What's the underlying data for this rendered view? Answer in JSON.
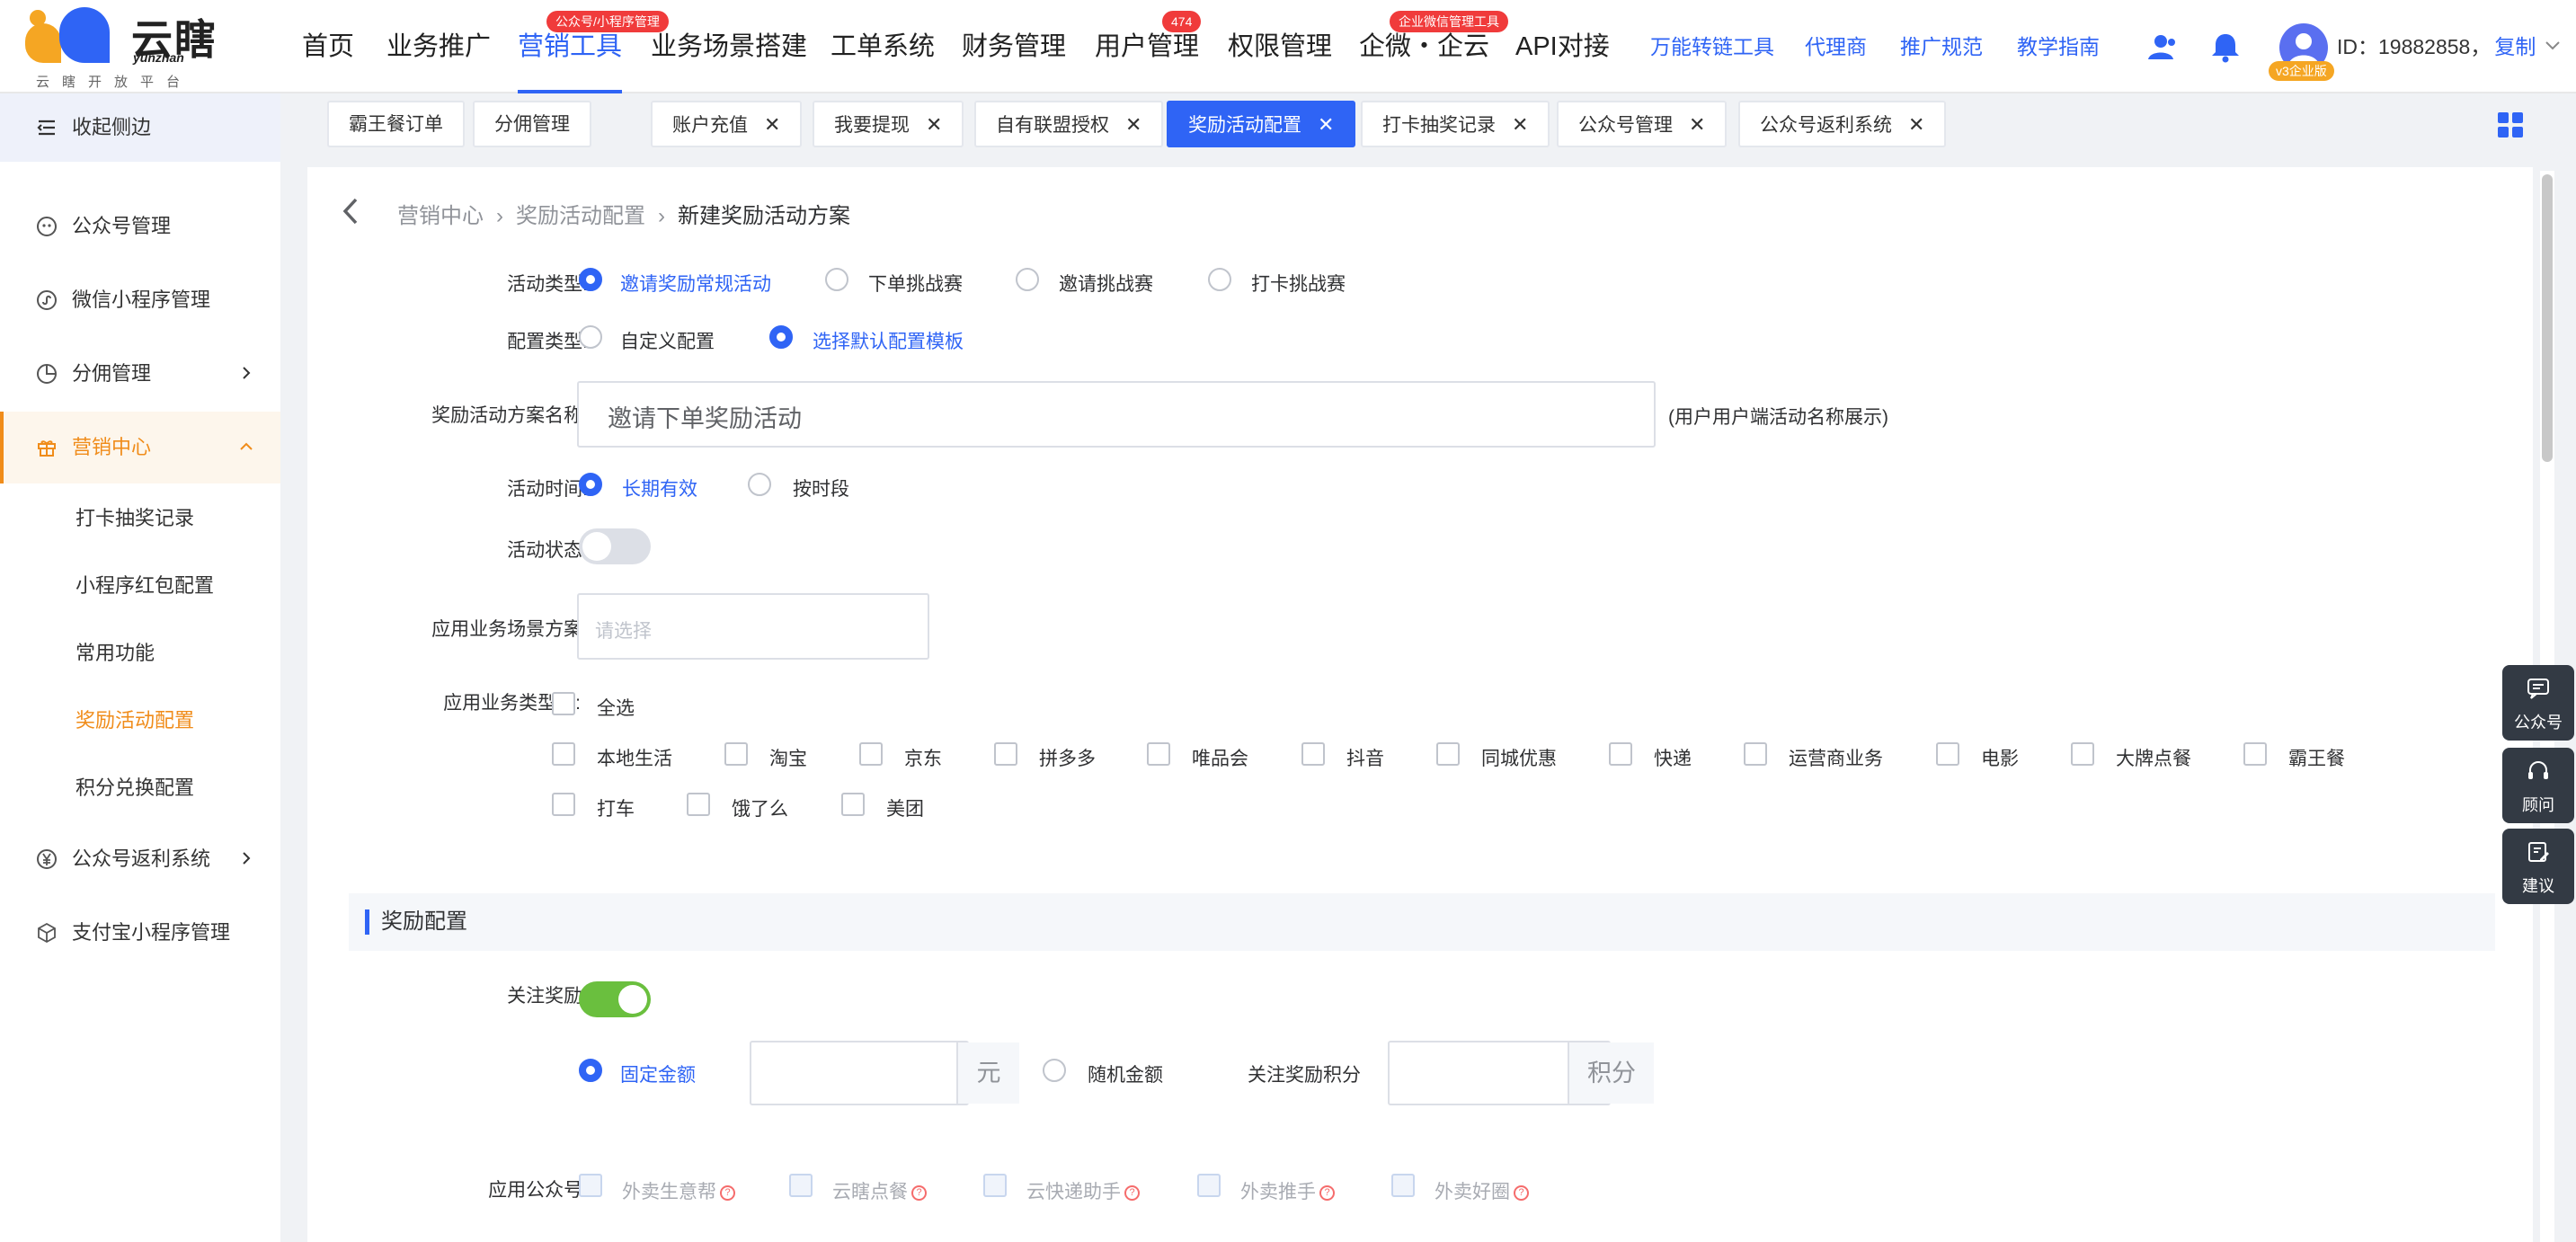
{
  "header": {
    "logo_text": "云瞎",
    "logo_en": "yunzhan",
    "logo_sub": "云瞎开放平台",
    "nav": [
      {
        "label": "首页"
      },
      {
        "label": "业务推广"
      },
      {
        "label": "营销工具",
        "badge": "公众号/小程序管理"
      },
      {
        "label": "业务场景搭建"
      },
      {
        "label": "工单系统"
      },
      {
        "label": "财务管理"
      },
      {
        "label": "用户管理",
        "badge": "474"
      },
      {
        "label": "权限管理"
      },
      {
        "label": "企微・企云",
        "badge": "企业微信管理工具"
      },
      {
        "label": "API对接"
      }
    ],
    "links": [
      "万能转链工具",
      "代理商",
      "推广规范",
      "教学指南"
    ],
    "user_id": "ID：19882858，",
    "copy_label": "复制",
    "avatar_badge": "v3企业版"
  },
  "sidebar": {
    "collapse_label": "收起侧边",
    "items": [
      {
        "label": "公众号管理"
      },
      {
        "label": "微信小程序管理"
      },
      {
        "label": "分佣管理"
      },
      {
        "label": "营销中心"
      },
      {
        "label": "公众号返利系统"
      },
      {
        "label": "支付宝小程序管理"
      }
    ],
    "sub_items": [
      {
        "label": "打卡抽奖记录"
      },
      {
        "label": "小程序红包配置"
      },
      {
        "label": "常用功能"
      },
      {
        "label": "奖励活动配置"
      },
      {
        "label": "积分兑换配置"
      }
    ]
  },
  "tabs": [
    {
      "label": "霸王餐订单"
    },
    {
      "label": "分佣管理"
    },
    {
      "label": "账户充值"
    },
    {
      "label": "我要提现"
    },
    {
      "label": "自有联盟授权"
    },
    {
      "label": "奖励活动配置"
    },
    {
      "label": "打卡抽奖记录"
    },
    {
      "label": "公众号管理"
    },
    {
      "label": "公众号返利系统"
    }
  ],
  "breadcrumb": [
    "营销中心",
    "奖励活动配置",
    "新建奖励活动方案"
  ],
  "form": {
    "activity_type_label": "活动类型:",
    "activity_types": [
      "邀请奖励常规活动",
      "下单挑战赛",
      "邀请挑战赛",
      "打卡挑战赛"
    ],
    "config_type_label": "配置类型:",
    "config_types": [
      "自定义配置",
      "选择默认配置模板"
    ],
    "name_label": "奖励活动方案名称:",
    "name_value": "邀请下单奖励活动",
    "name_hint": "(用户用户端活动名称展示)",
    "time_label": "活动时间:",
    "time_options": [
      "长期有效",
      "按时段"
    ],
    "status_label": "活动状态:",
    "scene_label": "应用业务场景方案:",
    "scene_placeholder": "请选择",
    "biz_type_label": "应用业务类型",
    "select_all": "全选",
    "biz_types": [
      "本地生活",
      "淘宝",
      "京东",
      "拼多多",
      "唯品会",
      "抖音",
      "同城优惠",
      "快递",
      "运营商业务",
      "电影",
      "大牌点餐",
      "霸王餐",
      "打车",
      "饿了么",
      "美团"
    ]
  },
  "reward": {
    "section_title": "奖励配置",
    "follow_label": "关注奖励:",
    "fixed_label": "固定金额",
    "unit_yuan": "元",
    "random_label": "随机金额",
    "points_label": "关注奖励积分",
    "unit_points": "积分",
    "apply_label": "应用公众号:",
    "accounts": [
      "外卖生意帮",
      "云瞎点餐",
      "云快递助手",
      "外卖推手",
      "外卖好圈"
    ]
  },
  "float": [
    "公众号",
    "顾问",
    "建议"
  ]
}
